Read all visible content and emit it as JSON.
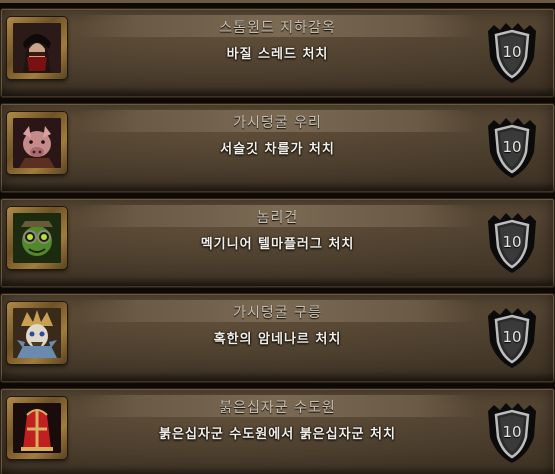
{
  "achievements": [
    {
      "title": "스톰윈드 지하감옥",
      "description": "바질 스레드 처치",
      "points": "10",
      "icon": "masked-bandit-portrait-icon",
      "icon_colors": [
        "#7a1010",
        "#2b1a18"
      ]
    },
    {
      "title": "가시덩굴 우리",
      "description": "서슬깃 차를가 처치",
      "points": "10",
      "icon": "boar-woman-portrait-icon",
      "icon_colors": [
        "#c58a8a",
        "#3a2020"
      ]
    },
    {
      "title": "놈리건",
      "description": "멕기니어 텔마플러그 처치",
      "points": "10",
      "icon": "gnome-goggles-portrait-icon",
      "icon_colors": [
        "#4f8a2a",
        "#1c2a10"
      ]
    },
    {
      "title": "가시덩굴 구릉",
      "description": "혹한의 암네나르 처치",
      "points": "10",
      "icon": "lich-portrait-icon",
      "icon_colors": [
        "#6a8ab0",
        "#3a2a1a"
      ]
    },
    {
      "title": "붉은십자군 수도원",
      "description": "붉은십자군 수도원에서 붉은십자군 처치",
      "points": "10",
      "icon": "crusader-mitre-portrait-icon",
      "icon_colors": [
        "#c02020",
        "#d8b060"
      ]
    }
  ]
}
